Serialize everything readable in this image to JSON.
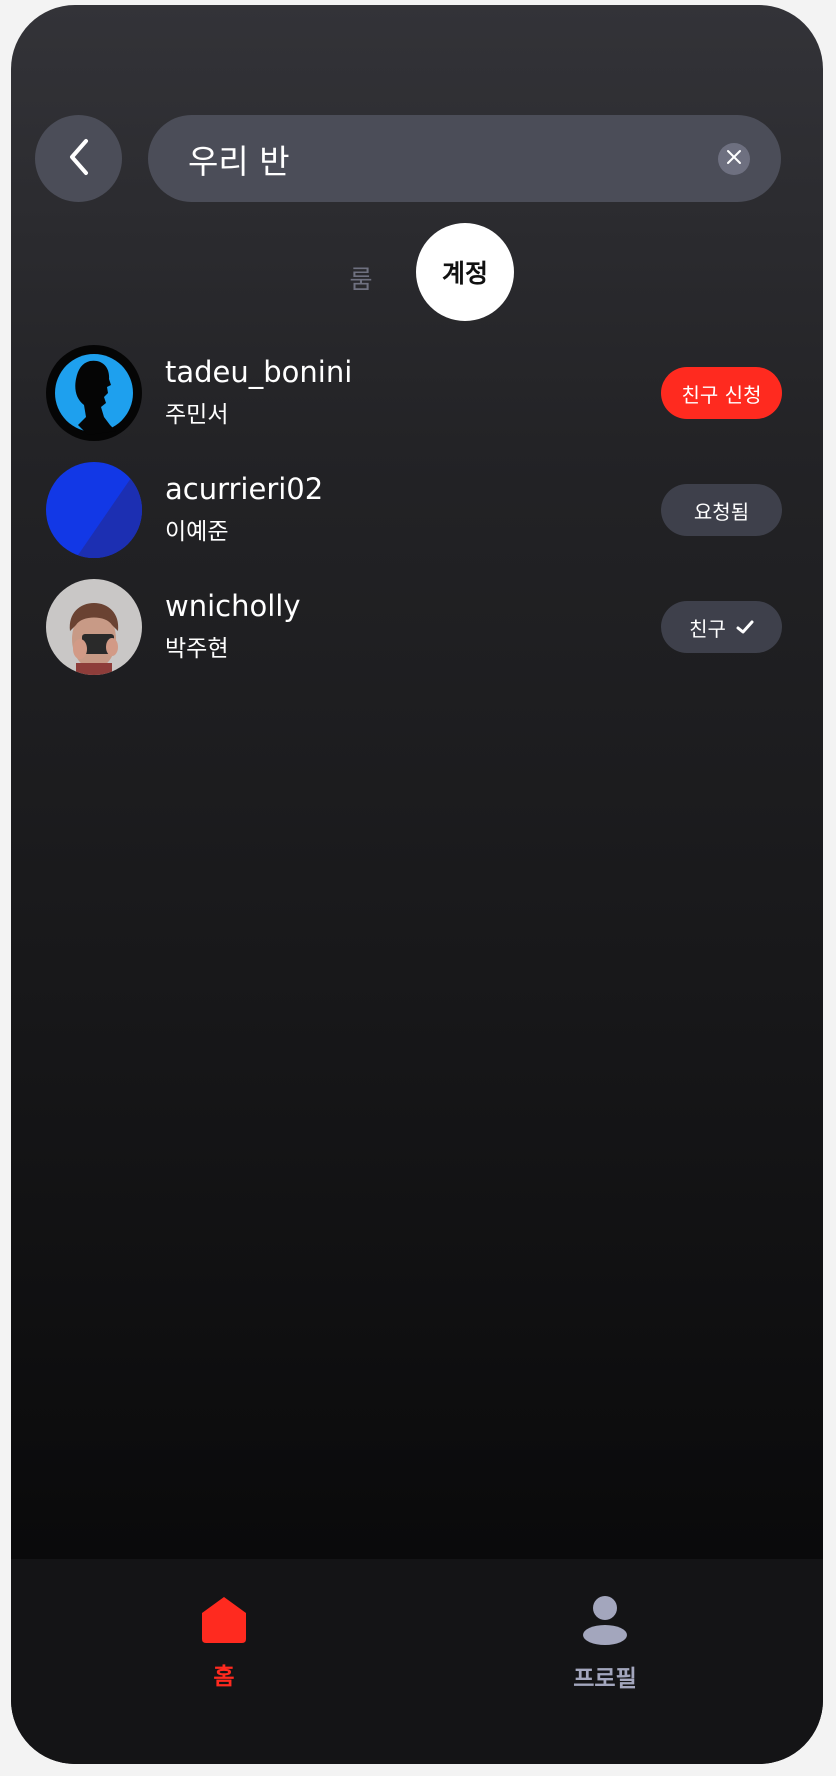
{
  "header": {
    "back_icon": "chevron-left-icon",
    "search_value": "우리 반",
    "clear_icon": "close-icon"
  },
  "tabs": [
    {
      "label": "룸",
      "active": false
    },
    {
      "label": "계정",
      "active": true
    }
  ],
  "accounts": [
    {
      "username": "tadeu_bonini",
      "name": "주민서",
      "action": "친구 신청",
      "action_style": "primary",
      "avatar": "silhouette-avatar"
    },
    {
      "username": "acurrieri02",
      "name": "이예준",
      "action": "요청됨",
      "action_style": "secondary",
      "avatar": "blue-avatar"
    },
    {
      "username": "wnicholly",
      "name": "박주현",
      "action": "친구",
      "action_icon": "checkmark-icon",
      "action_style": "secondary",
      "avatar": "photo-avatar"
    }
  ],
  "bottom_nav": [
    {
      "label": "홈",
      "icon": "home-icon",
      "active": true
    },
    {
      "label": "프로필",
      "icon": "profile-icon",
      "active": false
    }
  ],
  "colors": {
    "accent": "#ff2a1f",
    "inactive": "#a3a6bd",
    "surface": "#4b4d58"
  }
}
